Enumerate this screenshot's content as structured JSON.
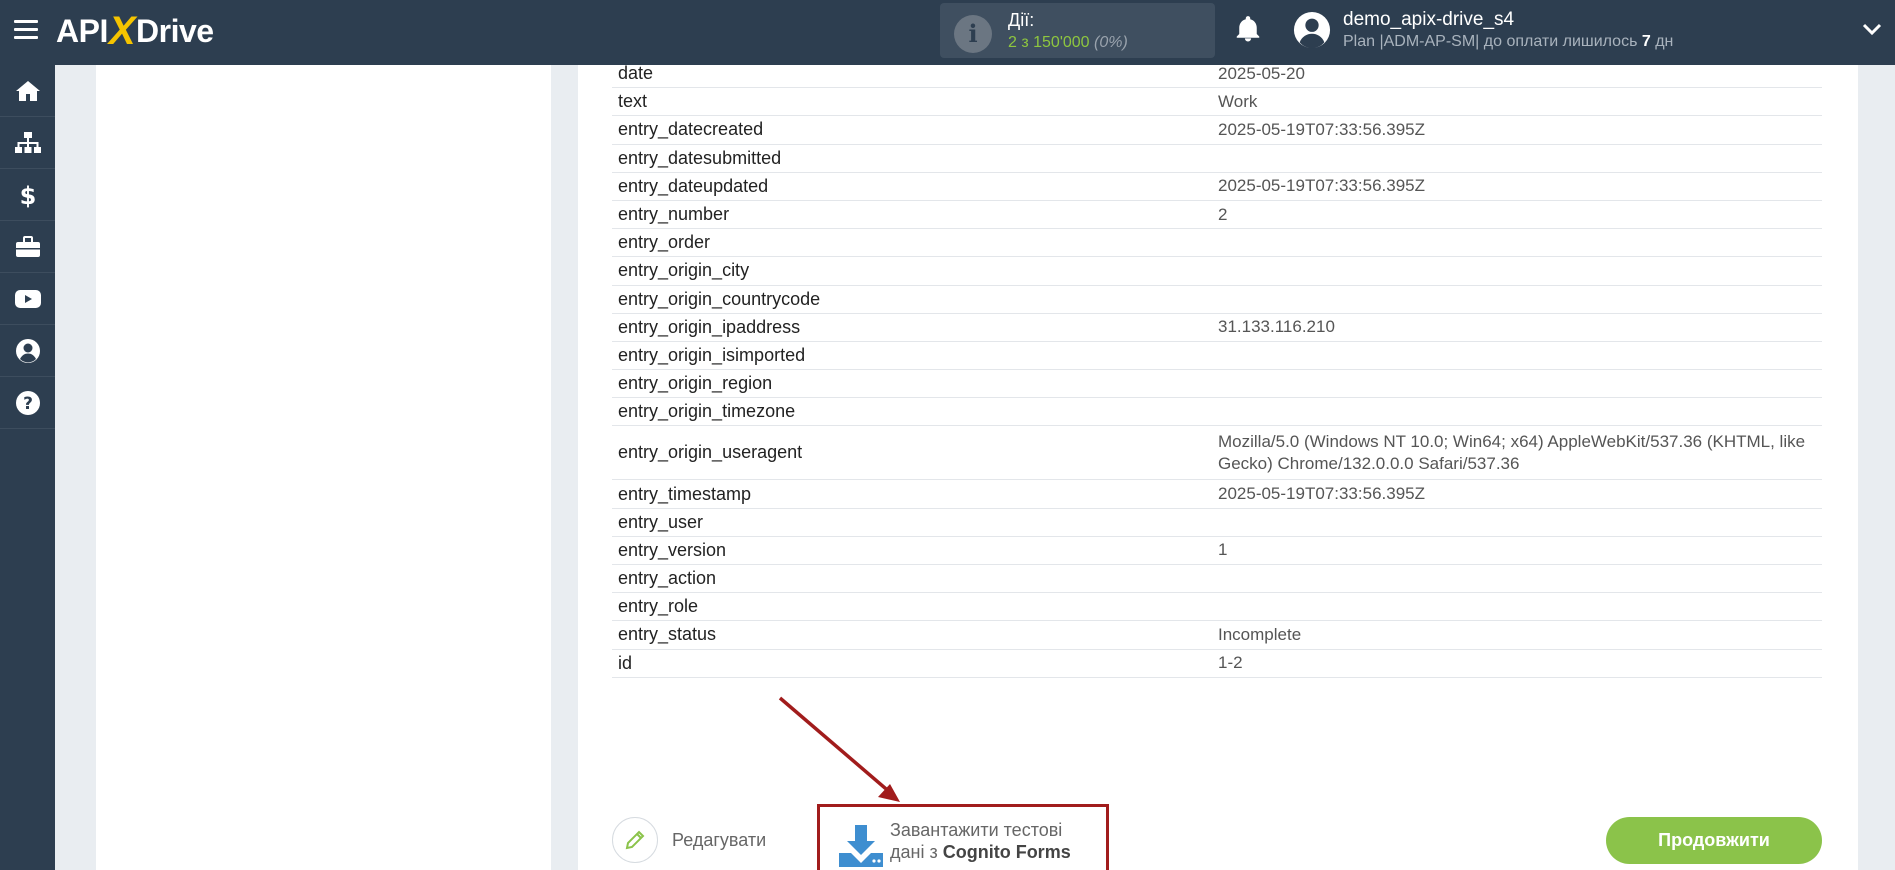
{
  "header": {
    "logo_text_left": "API",
    "logo_text_x": "X",
    "logo_text_right": "Drive",
    "actions_label": "Дії:",
    "actions_count": "2 з 150'000",
    "actions_percent": "(0%)",
    "username": "demo_apix-drive_s4",
    "plan_text": "Plan |ADM-AP-SM| до оплати лишилось ",
    "plan_days": "7",
    "plan_suffix": " дн"
  },
  "sidebar": {
    "items": [
      "home-icon",
      "sitemap-icon",
      "dollar-icon",
      "briefcase-icon",
      "youtube-icon",
      "user-icon",
      "help-icon"
    ]
  },
  "rows": [
    {
      "key": "date",
      "value": "2025-05-20"
    },
    {
      "key": "text",
      "value": "Work"
    },
    {
      "key": "entry_datecreated",
      "value": "2025-05-19T07:33:56.395Z"
    },
    {
      "key": "entry_datesubmitted",
      "value": ""
    },
    {
      "key": "entry_dateupdated",
      "value": "2025-05-19T07:33:56.395Z"
    },
    {
      "key": "entry_number",
      "value": "2"
    },
    {
      "key": "entry_order",
      "value": ""
    },
    {
      "key": "entry_origin_city",
      "value": ""
    },
    {
      "key": "entry_origin_countrycode",
      "value": ""
    },
    {
      "key": "entry_origin_ipaddress",
      "value": "31.133.116.210"
    },
    {
      "key": "entry_origin_isimported",
      "value": ""
    },
    {
      "key": "entry_origin_region",
      "value": ""
    },
    {
      "key": "entry_origin_timezone",
      "value": ""
    },
    {
      "key": "entry_origin_useragent",
      "value": "Mozilla/5.0 (Windows NT 10.0; Win64; x64) AppleWebKit/537.36 (KHTML, like Gecko) Chrome/132.0.0.0 Safari/537.36"
    },
    {
      "key": "entry_timestamp",
      "value": "2025-05-19T07:33:56.395Z"
    },
    {
      "key": "entry_user",
      "value": ""
    },
    {
      "key": "entry_version",
      "value": "1"
    },
    {
      "key": "entry_action",
      "value": ""
    },
    {
      "key": "entry_role",
      "value": ""
    },
    {
      "key": "entry_status",
      "value": "Incomplete"
    },
    {
      "key": "id",
      "value": "1-2"
    }
  ],
  "buttons": {
    "edit_label": "Редагувати",
    "load_line1": "Завантажити тестові",
    "load_line2_prefix": "дані з ",
    "load_line2_bold": "Cognito Forms",
    "continue_label": "Продовжити"
  },
  "colors": {
    "topbar": "#2d3e50",
    "accent_green": "#8bc34a",
    "highlight_red": "#a11c1c",
    "logo_yellow": "#f5c400"
  }
}
